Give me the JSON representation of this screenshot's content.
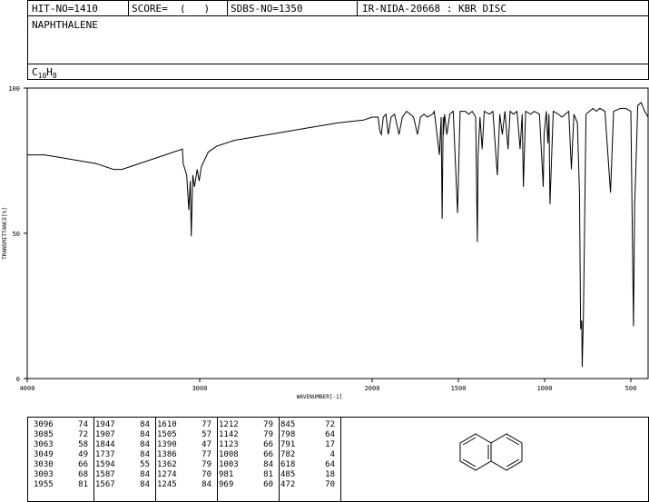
{
  "header": {
    "hit_no": "HIT-NO=1410",
    "score": "SCORE=  (   )",
    "sdbs_no": "SDBS-NO=1350",
    "ir_info": "IR-NIDA-20668 : KBR DISC"
  },
  "compound_name": "NAPHTHALENE",
  "formula": {
    "c": "C",
    "c_sub": "10",
    "h": "H",
    "h_sub": "8"
  },
  "chart_data": {
    "type": "line",
    "xlabel": "WAVENUMBER[-1]",
    "ylabel": "TRANSMITTANCE[%]",
    "xlim": [
      4000,
      400
    ],
    "ylim": [
      0,
      100
    ],
    "x_ticks": [
      4000,
      3000,
      2000,
      1500,
      1000,
      500
    ],
    "y_ticks": [
      0,
      50,
      100
    ],
    "x_tick_labels": [
      "4000",
      "3000",
      "2000",
      "1500",
      "1000",
      "500"
    ],
    "y_tick_labels": [
      "0",
      "50",
      "100"
    ],
    "grid": false,
    "series": [
      {
        "x": [
          4000,
          3900,
          3800,
          3700,
          3600,
          3500,
          3450,
          3400,
          3300,
          3200,
          3100,
          3096,
          3085,
          3075,
          3063,
          3055,
          3049,
          3040,
          3030,
          3015,
          3003,
          2990,
          2950,
          2900,
          2800,
          2600,
          2400,
          2200,
          2050,
          2000,
          1966,
          1955,
          1947,
          1935,
          1920,
          1907,
          1890,
          1870,
          1844,
          1825,
          1800,
          1780,
          1760,
          1737,
          1720,
          1700,
          1680,
          1650,
          1640,
          1610,
          1600,
          1594,
          1588,
          1587,
          1580,
          1567,
          1550,
          1530,
          1505,
          1490,
          1460,
          1440,
          1420,
          1400,
          1390,
          1386,
          1375,
          1362,
          1350,
          1320,
          1300,
          1274,
          1260,
          1245,
          1230,
          1212,
          1200,
          1180,
          1160,
          1142,
          1130,
          1123,
          1110,
          1080,
          1060,
          1030,
          1008,
          1003,
          990,
          981,
          975,
          969,
          950,
          920,
          900,
          880,
          860,
          845,
          830,
          810,
          798,
          791,
          785,
          782,
          775,
          760,
          740,
          720,
          700,
          680,
          650,
          618,
          600,
          560,
          530,
          500,
          485,
          478,
          472,
          460,
          440,
          420,
          400
        ],
        "y": [
          77,
          77,
          76,
          75,
          74,
          72,
          72,
          73,
          75,
          77,
          79,
          74,
          72,
          70,
          58,
          68,
          49,
          70,
          66,
          72,
          68,
          73,
          78,
          80,
          82,
          84,
          86,
          88,
          89,
          90,
          90,
          85,
          84,
          90,
          91,
          84,
          90,
          91,
          84,
          90,
          92,
          91,
          90,
          84,
          90,
          91,
          90,
          91,
          92,
          77,
          90,
          55,
          90,
          84,
          91,
          84,
          91,
          92,
          57,
          92,
          92,
          91,
          92,
          90,
          47,
          77,
          90,
          79,
          92,
          91,
          92,
          70,
          91,
          84,
          92,
          79,
          92,
          91,
          92,
          79,
          91,
          66,
          92,
          91,
          92,
          91,
          66,
          84,
          92,
          81,
          91,
          60,
          92,
          91,
          90,
          91,
          92,
          72,
          91,
          88,
          64,
          17,
          20,
          4,
          22,
          91,
          92,
          93,
          92,
          93,
          92,
          64,
          92,
          93,
          93,
          92,
          18,
          60,
          70,
          94,
          95,
          92,
          90
        ]
      }
    ]
  },
  "peak_table": {
    "columns": [
      [
        [
          "3096",
          "74"
        ],
        [
          "3085",
          "72"
        ],
        [
          "3063",
          "58"
        ],
        [
          "3049",
          "49"
        ],
        [
          "3030",
          "66"
        ],
        [
          "3003",
          "68"
        ],
        [
          "1955",
          "81"
        ]
      ],
      [
        [
          "1947",
          "84"
        ],
        [
          "1907",
          "84"
        ],
        [
          "1844",
          "84"
        ],
        [
          "1737",
          "84"
        ],
        [
          "1594",
          "55"
        ],
        [
          "1587",
          "84"
        ],
        [
          "1567",
          "84"
        ]
      ],
      [
        [
          "1610",
          "77"
        ],
        [
          "1505",
          "57"
        ],
        [
          "1390",
          "47"
        ],
        [
          "1386",
          "77"
        ],
        [
          "1362",
          "79"
        ],
        [
          "1274",
          "70"
        ],
        [
          "1245",
          "84"
        ]
      ],
      [
        [
          "1212",
          "79"
        ],
        [
          "1142",
          "79"
        ],
        [
          "1123",
          "66"
        ],
        [
          "1008",
          "66"
        ],
        [
          "1003",
          "84"
        ],
        [
          "981",
          "81"
        ],
        [
          "969",
          "60"
        ]
      ],
      [
        [
          "845",
          "72"
        ],
        [
          "798",
          "64"
        ],
        [
          "791",
          "17"
        ],
        [
          "782",
          "4"
        ],
        [
          "618",
          "64"
        ],
        [
          "485",
          "18"
        ],
        [
          "472",
          "70"
        ]
      ]
    ]
  }
}
